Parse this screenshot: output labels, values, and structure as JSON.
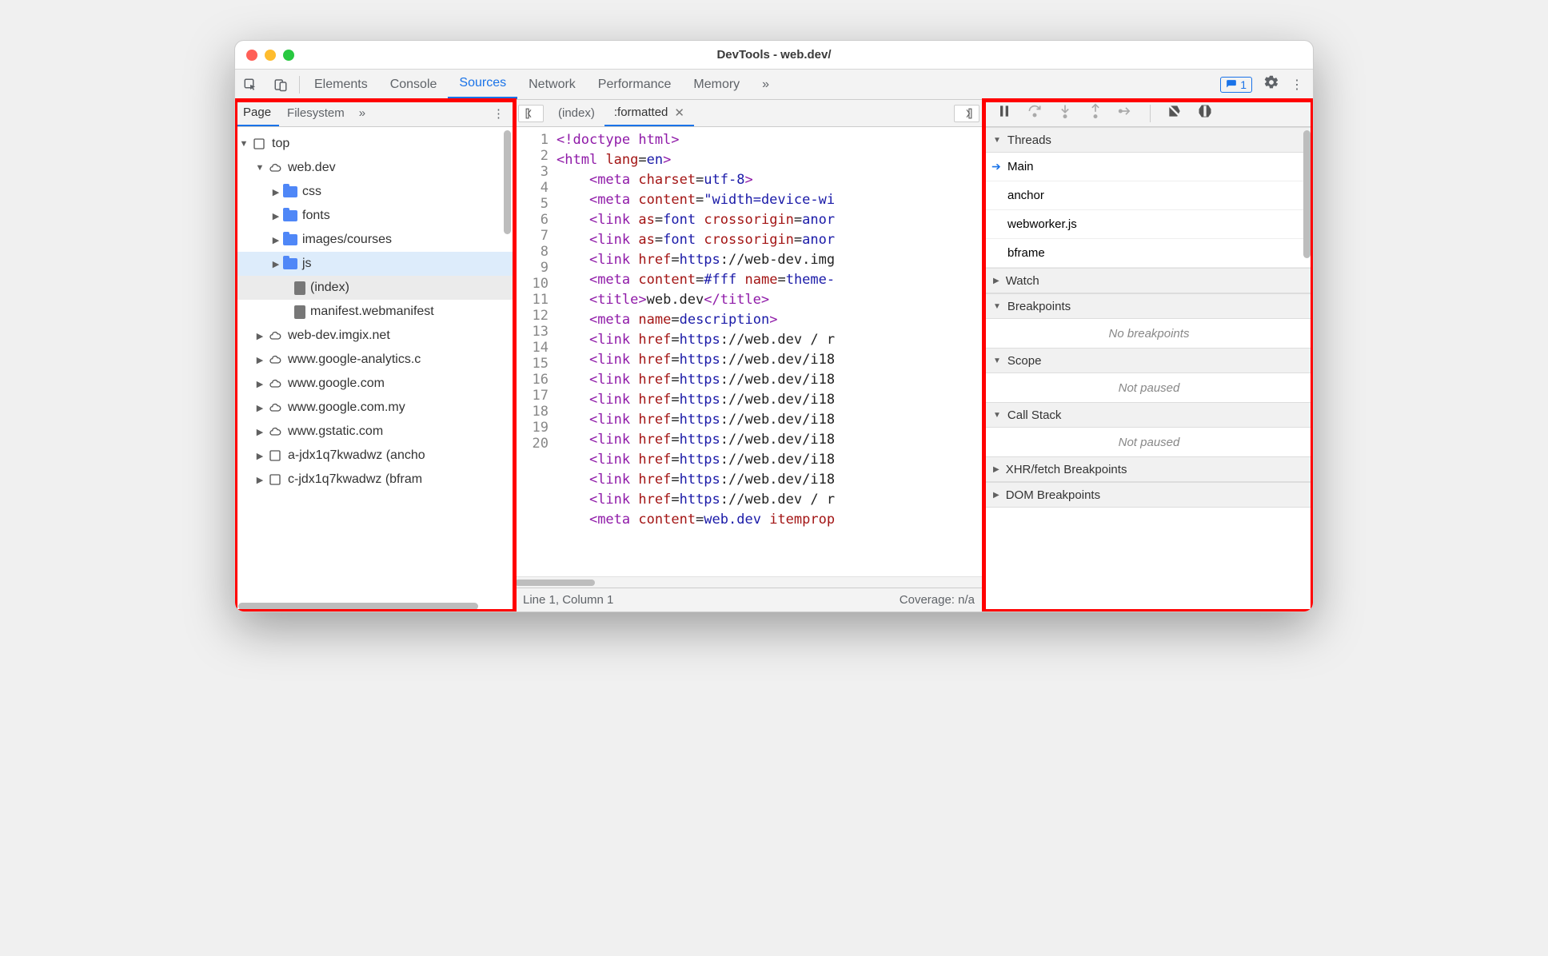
{
  "window": {
    "title": "DevTools - web.dev/"
  },
  "toolbar": {
    "tabs": [
      "Elements",
      "Console",
      "Sources",
      "Network",
      "Performance",
      "Memory"
    ],
    "active_tab": "Sources",
    "badge_count": "1"
  },
  "left": {
    "subtabs": [
      "Page",
      "Filesystem"
    ],
    "active_subtab": "Page",
    "tree": {
      "top": "top",
      "domain": "web.dev",
      "folders": [
        "css",
        "fonts",
        "images/courses",
        "js"
      ],
      "files": [
        "(index)",
        "manifest.webmanifest"
      ],
      "other_origins": [
        "web-dev.imgix.net",
        "www.google-analytics.c",
        "www.google.com",
        "www.google.com.my",
        "www.gstatic.com"
      ],
      "frames": [
        "a-jdx1q7kwadwz (ancho",
        "c-jdx1q7kwadwz (bfram"
      ]
    }
  },
  "center": {
    "tabs": [
      {
        "label": "(index)",
        "active": false,
        "closable": false
      },
      {
        "label": ":formatted",
        "active": true,
        "closable": true
      }
    ],
    "lines": [
      {
        "n": 1,
        "html": "<span class='tag'>&lt;!doctype html&gt;</span>"
      },
      {
        "n": 2,
        "html": "<span class='tag'>&lt;html</span> <span class='attr'>lang</span>=<span class='val'>en</span><span class='tag'>&gt;</span>"
      },
      {
        "n": 3,
        "html": "    <span class='tag'>&lt;meta</span> <span class='attr'>charset</span>=<span class='val'>utf-8</span><span class='tag'>&gt;</span>"
      },
      {
        "n": 4,
        "html": "    <span class='tag'>&lt;meta</span> <span class='attr'>content</span>=<span class='val'>\"width=device-wi</span>"
      },
      {
        "n": 5,
        "html": "    <span class='tag'>&lt;link</span> <span class='attr'>as</span>=<span class='val'>font</span> <span class='attr'>crossorigin</span>=<span class='val'>anor</span>"
      },
      {
        "n": 6,
        "html": "    <span class='tag'>&lt;link</span> <span class='attr'>as</span>=<span class='val'>font</span> <span class='attr'>crossorigin</span>=<span class='val'>anor</span>"
      },
      {
        "n": 7,
        "html": "    <span class='tag'>&lt;link</span> <span class='attr'>href</span>=<span class='val'>https</span>://web-dev.img"
      },
      {
        "n": 8,
        "html": "    <span class='tag'>&lt;meta</span> <span class='attr'>content</span>=<span class='val'>#fff</span> <span class='attr'>name</span>=<span class='val'>theme-</span>"
      },
      {
        "n": 9,
        "html": "    <span class='tag'>&lt;title&gt;</span>web.dev<span class='tag'>&lt;/title&gt;</span>"
      },
      {
        "n": 10,
        "html": "    <span class='tag'>&lt;meta</span> <span class='attr'>name</span>=<span class='val'>description</span><span class='tag'>&gt;</span>"
      },
      {
        "n": 11,
        "html": "    <span class='tag'>&lt;link</span> <span class='attr'>href</span>=<span class='val'>https</span>://web.dev / r"
      },
      {
        "n": 12,
        "html": "    <span class='tag'>&lt;link</span> <span class='attr'>href</span>=<span class='val'>https</span>://web.dev/i18"
      },
      {
        "n": 13,
        "html": "    <span class='tag'>&lt;link</span> <span class='attr'>href</span>=<span class='val'>https</span>://web.dev/i18"
      },
      {
        "n": 14,
        "html": "    <span class='tag'>&lt;link</span> <span class='attr'>href</span>=<span class='val'>https</span>://web.dev/i18"
      },
      {
        "n": 15,
        "html": "    <span class='tag'>&lt;link</span> <span class='attr'>href</span>=<span class='val'>https</span>://web.dev/i18"
      },
      {
        "n": 16,
        "html": "    <span class='tag'>&lt;link</span> <span class='attr'>href</span>=<span class='val'>https</span>://web.dev/i18"
      },
      {
        "n": 17,
        "html": "    <span class='tag'>&lt;link</span> <span class='attr'>href</span>=<span class='val'>https</span>://web.dev/i18"
      },
      {
        "n": 18,
        "html": "    <span class='tag'>&lt;link</span> <span class='attr'>href</span>=<span class='val'>https</span>://web.dev/i18"
      },
      {
        "n": 19,
        "html": "    <span class='tag'>&lt;link</span> <span class='attr'>href</span>=<span class='val'>https</span>://web.dev / r"
      },
      {
        "n": 20,
        "html": "    <span class='tag'>&lt;meta</span> <span class='attr'>content</span>=<span class='val'>web.dev</span> <span class='attr'>itemprop</span>"
      }
    ],
    "status_left": "Line 1, Column 1",
    "status_right": "Coverage: n/a"
  },
  "right": {
    "sections": {
      "threads": {
        "label": "Threads",
        "expanded": true,
        "items": [
          "Main",
          "anchor",
          "webworker.js",
          "bframe"
        ],
        "current": "Main"
      },
      "watch": {
        "label": "Watch",
        "expanded": false
      },
      "breakpoints": {
        "label": "Breakpoints",
        "expanded": true,
        "empty": "No breakpoints"
      },
      "scope": {
        "label": "Scope",
        "expanded": true,
        "empty": "Not paused"
      },
      "callstack": {
        "label": "Call Stack",
        "expanded": true,
        "empty": "Not paused"
      },
      "xhr": {
        "label": "XHR/fetch Breakpoints",
        "expanded": false
      },
      "dom": {
        "label": "DOM Breakpoints",
        "expanded": false
      }
    }
  }
}
